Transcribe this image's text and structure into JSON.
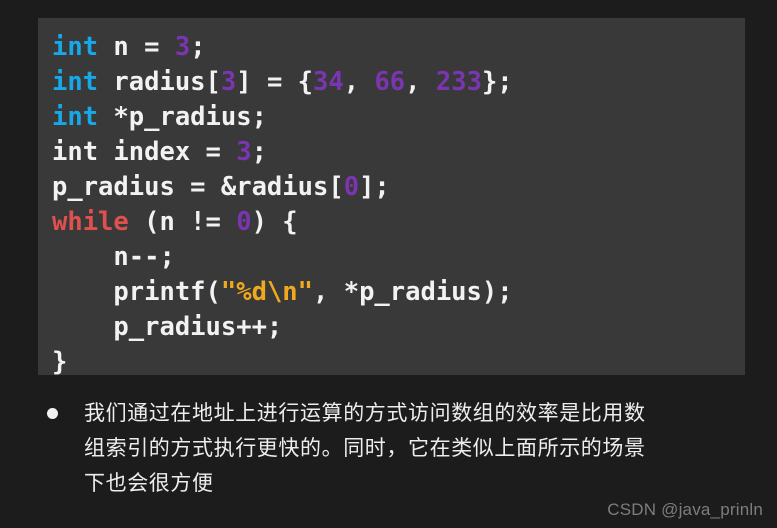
{
  "code": {
    "language": "c",
    "background_color": "#393939",
    "colors": {
      "type_keyword": "#16a8e8",
      "control_keyword": "#e0504e",
      "number": "#7b35b0",
      "string": "#f0a81e",
      "plain_text": "#f2f2f2"
    },
    "lines": [
      [
        {
          "t": "int",
          "c": "kw-type"
        },
        {
          "t": " n = ",
          "c": "plain"
        },
        {
          "t": "3",
          "c": "num"
        },
        {
          "t": ";",
          "c": "plain"
        }
      ],
      [
        {
          "t": "int",
          "c": "kw-type"
        },
        {
          "t": " radius[",
          "c": "plain"
        },
        {
          "t": "3",
          "c": "num"
        },
        {
          "t": "] = {",
          "c": "plain"
        },
        {
          "t": "34",
          "c": "num"
        },
        {
          "t": ", ",
          "c": "plain"
        },
        {
          "t": "66",
          "c": "num"
        },
        {
          "t": ", ",
          "c": "plain"
        },
        {
          "t": "233",
          "c": "num"
        },
        {
          "t": "};",
          "c": "plain"
        }
      ],
      [
        {
          "t": "int",
          "c": "kw-type"
        },
        {
          "t": " *p_radius;",
          "c": "plain"
        }
      ],
      [
        {
          "t": "int index = ",
          "c": "plain"
        },
        {
          "t": "3",
          "c": "num"
        },
        {
          "t": ";",
          "c": "plain"
        }
      ],
      [
        {
          "t": "p_radius = &radius[",
          "c": "plain"
        },
        {
          "t": "0",
          "c": "num"
        },
        {
          "t": "];",
          "c": "plain"
        }
      ],
      [
        {
          "t": "while",
          "c": "kw-ctrl"
        },
        {
          "t": " (n != ",
          "c": "plain"
        },
        {
          "t": "0",
          "c": "num"
        },
        {
          "t": ") {",
          "c": "plain"
        }
      ],
      [
        {
          "t": "    n--;",
          "c": "plain"
        }
      ],
      [
        {
          "t": "    printf(",
          "c": "plain"
        },
        {
          "t": "\"%d\\n\"",
          "c": "str"
        },
        {
          "t": ", *p_radius);",
          "c": "plain"
        }
      ],
      [
        {
          "t": "    p_radius++;",
          "c": "plain"
        }
      ],
      [
        {
          "t": "}",
          "c": "plain"
        }
      ]
    ]
  },
  "note": {
    "bullet": "•",
    "lines": [
      "我们通过在地址上进行运算的方式访问数组的效率是比用数",
      "组索引的方式执行更快的。同时，它在类似上面所示的场景",
      "下也会很方便"
    ]
  },
  "watermark": {
    "text": "CSDN @java_prinln"
  }
}
